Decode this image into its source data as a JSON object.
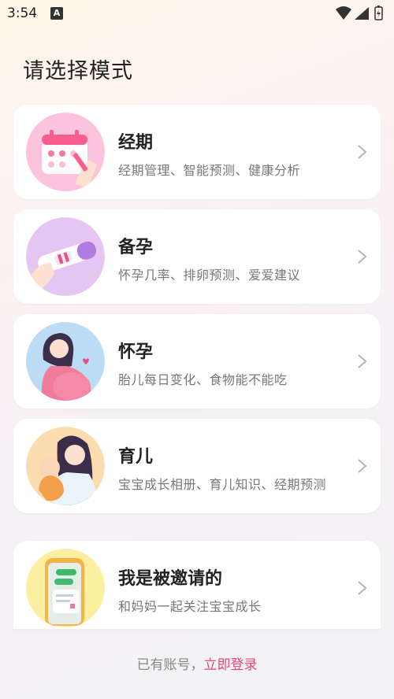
{
  "status": {
    "time": "3:54",
    "notif_glyph": "A"
  },
  "page": {
    "title": "请选择模式"
  },
  "modes": [
    {
      "title": "经期",
      "desc": "经期管理、智能预测、健康分析",
      "icon": "calendar-icon"
    },
    {
      "title": "备孕",
      "desc": "怀孕几率、排卵预测、爱爱建议",
      "icon": "ovulation-test-icon"
    },
    {
      "title": "怀孕",
      "desc": "胎儿每日变化、食物能不能吃",
      "icon": "pregnant-woman-icon"
    },
    {
      "title": "育儿",
      "desc": "宝宝成长相册、育儿知识、经期预测",
      "icon": "mother-baby-icon"
    },
    {
      "title": "我是被邀请的",
      "desc": "和妈妈一起关注宝宝成长",
      "icon": "phone-chat-icon"
    }
  ],
  "footer": {
    "prefix": "已有账号，",
    "login": "立即登录"
  }
}
